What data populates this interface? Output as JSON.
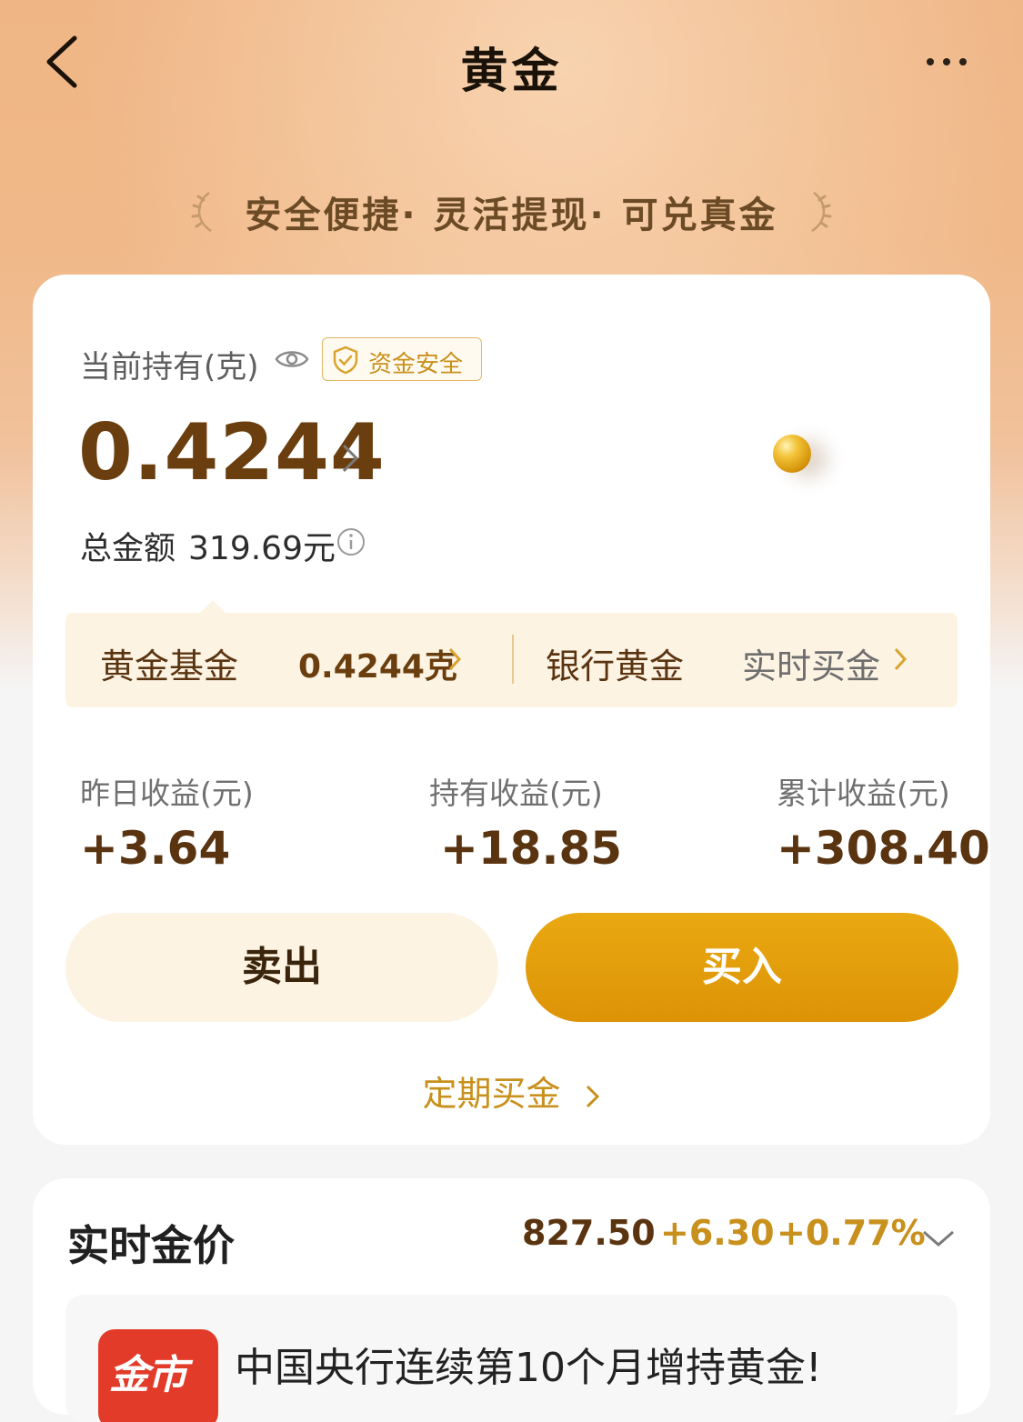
{
  "header": {
    "title": "黄金",
    "slogan": "安全便捷· 灵活提现· 可兑真金"
  },
  "holding": {
    "label": "当前持有(克)",
    "badge": "资金安全",
    "amount": "0.4244",
    "total_label": "总金额",
    "total_value": "319.69元"
  },
  "products": {
    "fund_label": "黄金基金",
    "fund_value": "0.4244克",
    "bank_label": "银行黄金",
    "bank_action": "实时买金"
  },
  "earnings": [
    {
      "label": "昨日收益(元)",
      "value": "+3.64"
    },
    {
      "label": "持有收益(元)",
      "value": "+18.85"
    },
    {
      "label": "累计收益(元)",
      "value": "+308.40"
    }
  ],
  "actions": {
    "sell": "卖出",
    "buy": "买入",
    "sip": "定期买金"
  },
  "price": {
    "title": "实时金价",
    "value": "827.50",
    "change": "+6.30",
    "change_pct": "+0.77%"
  },
  "news": {
    "logo_text": "金市",
    "title": "中国央行连续第10个月增持黄金!"
  },
  "colors": {
    "brand_gold": "#dd9306",
    "text_brown": "#6a3e0e",
    "price_up": "#c8901c"
  },
  "icons": [
    "back-icon",
    "more-icon",
    "eye-icon",
    "shield-icon",
    "chevron-right-icon",
    "info-icon",
    "chevron-down-icon"
  ]
}
